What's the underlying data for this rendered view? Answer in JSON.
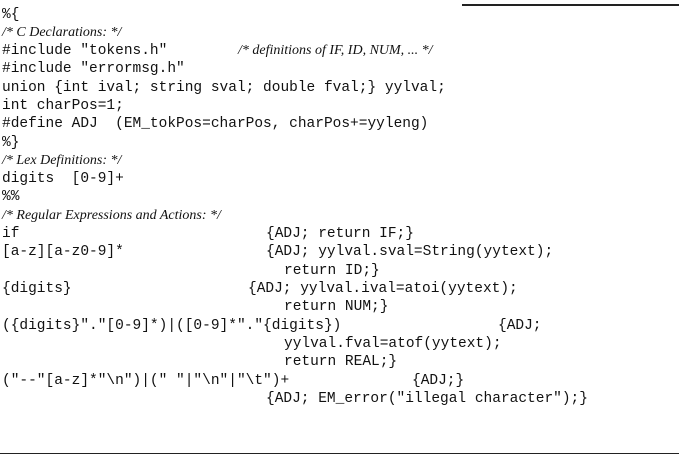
{
  "code": {
    "l1": "%{",
    "c1": "/* C Declarations: */",
    "l2": "#include \"tokens.h\"",
    "c2": "/* definitions of IF, ID, NUM, ... */",
    "l3": "#include \"errormsg.h\"",
    "l4": "union {int ival; string sval; double fval;} yylval;",
    "l5": "int charPos=1;",
    "l6": "#define ADJ  (EM_tokPos=charPos, charPos+=yyleng)",
    "l7": "%}",
    "c3": "/* Lex Definitions: */",
    "l8": "digits  [0-9]+",
    "l9": "%%",
    "c4": "/* Regular Expressions and Actions: */",
    "l10a": "if",
    "l10b": "{ADJ; return IF;}",
    "l11a": "[a-z][a-z0-9]*",
    "l11b": "{ADJ; yylval.sval=String(yytext);",
    "l12": "return ID;}",
    "l13a": "{digits}",
    "l13b": "{ADJ; yylval.ival=atoi(yytext);",
    "l14": "return NUM;}",
    "l15a": "({digits}\".\"[0-9]*)|([0-9]*\".\"{digits})",
    "l15b": "{ADJ;",
    "l16": "yylval.fval=atof(yytext);",
    "l17": "return REAL;}",
    "l18a": "(\"--\"[a-z]*\"\\n\")|(\" \"|\"\\n\"|\"\\t\")+",
    "l18b": "{ADJ;}",
    "l19": "{ADJ; EM_error(\"illegal character\");}"
  }
}
